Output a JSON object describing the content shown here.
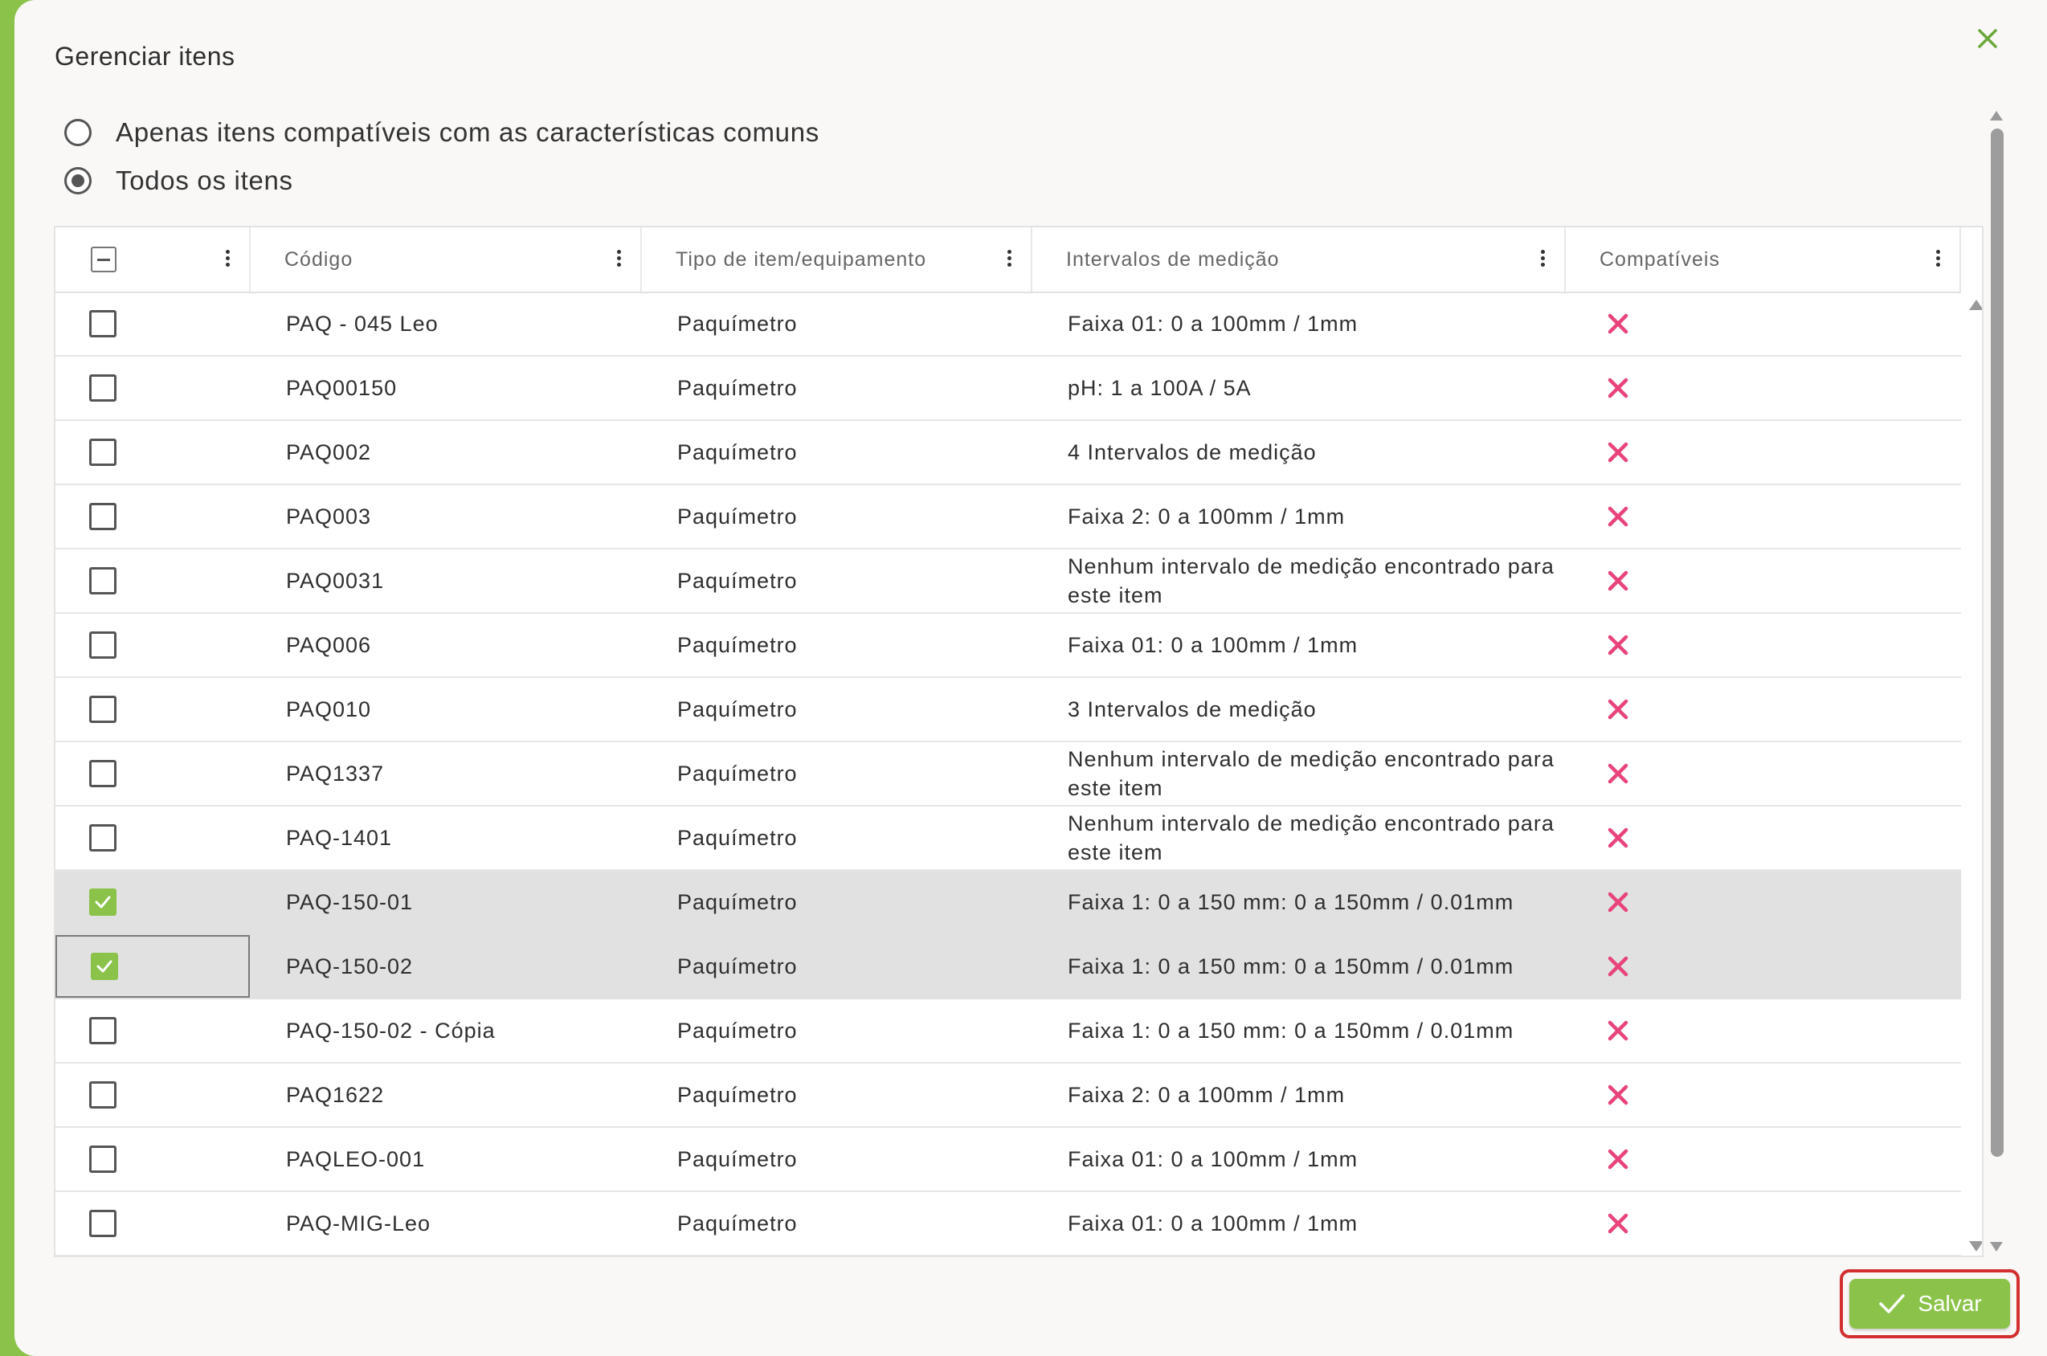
{
  "dialog": {
    "title": "Gerenciar itens",
    "close_icon": "close-icon",
    "accent_color": "#8bc34a",
    "highlight_color": "#d32f2f",
    "incompatible_color": "#e8437a"
  },
  "filter": {
    "options": [
      {
        "label": "Apenas itens compatíveis com as características comuns",
        "selected": false
      },
      {
        "label": "Todos os itens",
        "selected": true
      }
    ]
  },
  "table": {
    "columns": [
      {
        "label": ""
      },
      {
        "label": "Código"
      },
      {
        "label": "Tipo de item/equipamento"
      },
      {
        "label": "Intervalos de medição"
      },
      {
        "label": "Compatíveis"
      }
    ],
    "header_checkbox_state": "indeterminate",
    "rows": [
      {
        "code": "PAQ - 045 Leo",
        "type": "Paquímetro",
        "range": "Faixa 01: 0 a 100mm / 1mm",
        "compatible": false,
        "checked": false
      },
      {
        "code": "PAQ00150",
        "type": "Paquímetro",
        "range": "pH: 1 a 100A / 5A",
        "compatible": false,
        "checked": false
      },
      {
        "code": "PAQ002",
        "type": "Paquímetro",
        "range": "4 Intervalos de medição",
        "compatible": false,
        "checked": false
      },
      {
        "code": "PAQ003",
        "type": "Paquímetro",
        "range": "Faixa 2: 0 a 100mm / 1mm",
        "compatible": false,
        "checked": false
      },
      {
        "code": "PAQ0031",
        "type": "Paquímetro",
        "range": "Nenhum intervalo de medição encontrado para este item",
        "compatible": false,
        "checked": false
      },
      {
        "code": "PAQ006",
        "type": "Paquímetro",
        "range": "Faixa 01: 0 a 100mm / 1mm",
        "compatible": false,
        "checked": false
      },
      {
        "code": "PAQ010",
        "type": "Paquímetro",
        "range": "3 Intervalos de medição",
        "compatible": false,
        "checked": false
      },
      {
        "code": "PAQ1337",
        "type": "Paquímetro",
        "range": "Nenhum intervalo de medição encontrado para este item",
        "compatible": false,
        "checked": false
      },
      {
        "code": "PAQ-1401",
        "type": "Paquímetro",
        "range": "Nenhum intervalo de medição encontrado para este item",
        "compatible": false,
        "checked": false
      },
      {
        "code": "PAQ-150-01",
        "type": "Paquímetro",
        "range": "Faixa 1: 0 a 150 mm: 0 a 150mm / 0.01mm",
        "compatible": false,
        "checked": true
      },
      {
        "code": "PAQ-150-02",
        "type": "Paquímetro",
        "range": "Faixa 1: 0 a 150 mm: 0 a 150mm / 0.01mm",
        "compatible": false,
        "checked": true
      },
      {
        "code": "PAQ-150-02 - Cópia",
        "type": "Paquímetro",
        "range": "Faixa 1: 0 a 150 mm: 0 a 150mm / 0.01mm",
        "compatible": false,
        "checked": false
      },
      {
        "code": "PAQ1622",
        "type": "Paquímetro",
        "range": "Faixa 2: 0 a 100mm / 1mm",
        "compatible": false,
        "checked": false
      },
      {
        "code": "PAQLEO-001",
        "type": "Paquímetro",
        "range": "Faixa 01: 0 a 100mm / 1mm",
        "compatible": false,
        "checked": false
      },
      {
        "code": "PAQ-MIG-Leo",
        "type": "Paquímetro",
        "range": "Faixa 01: 0 a 100mm / 1mm",
        "compatible": false,
        "checked": false
      }
    ]
  },
  "footer": {
    "save_label": "Salvar",
    "save_icon": "check-icon"
  }
}
